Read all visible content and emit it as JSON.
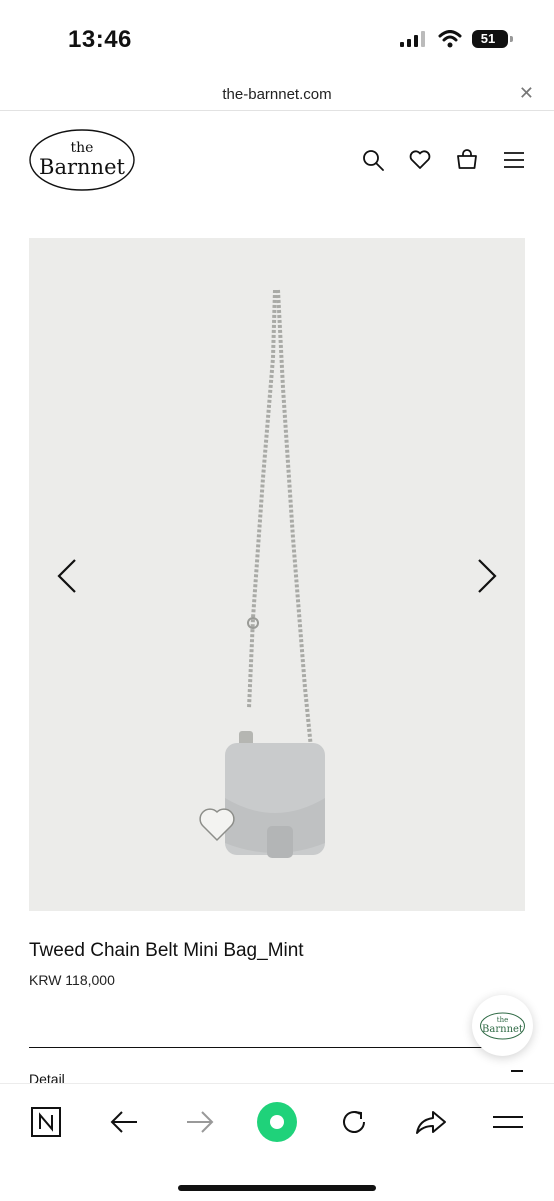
{
  "status": {
    "time": "13:46",
    "battery": "51"
  },
  "browser": {
    "url": "the-barnnet.com"
  },
  "site": {
    "logo_top": "the",
    "logo_bottom": "Barnnet"
  },
  "product": {
    "title": "Tweed Chain Belt Mini Bag_Mint",
    "price": "KRW 118,000",
    "detail_label": "Detail",
    "image_bg": "#ececea"
  },
  "floating_logo": {
    "top": "the",
    "bottom": "Barnnet",
    "color": "#2f6a45"
  },
  "bottom_nav": {
    "items": [
      "n-home-icon",
      "back-arrow-icon",
      "forward-arrow-icon",
      "green-dot-icon",
      "refresh-icon",
      "share-icon",
      "menu-icon"
    ],
    "accent": "#1fd27a"
  }
}
